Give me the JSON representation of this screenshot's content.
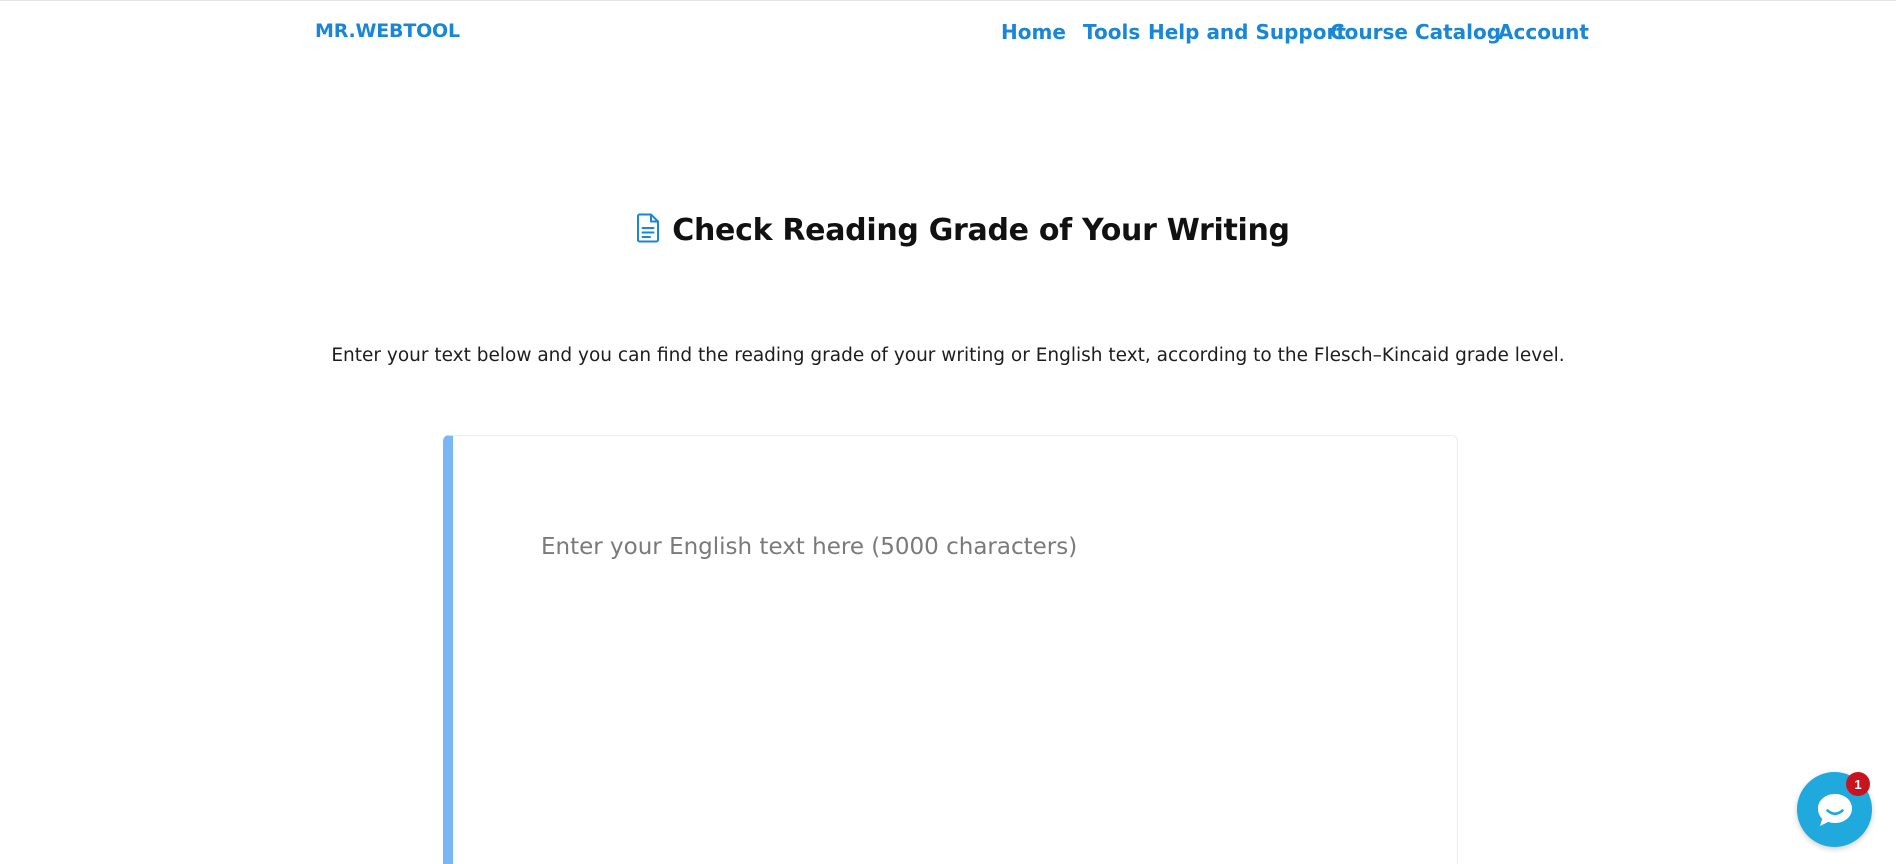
{
  "brand": {
    "name": "MR.WEBTOOL"
  },
  "nav": {
    "items": [
      {
        "label": "Home"
      },
      {
        "label": "Tools"
      },
      {
        "label": "Help and Support"
      },
      {
        "label": "Course Catalog"
      },
      {
        "label": "Account"
      }
    ]
  },
  "main": {
    "title": "Check Reading Grade of Your Writing",
    "icon": "document-icon",
    "description": "Enter your text below and you can find the reading grade of your writing or English text, according to the Flesch–Kincaid grade level.",
    "editor": {
      "placeholder": "Enter your English text here (5000 characters)",
      "value": ""
    }
  },
  "chat": {
    "icon": "chat-bubble-icon",
    "badge_count": "1"
  },
  "colors": {
    "brand": "#1a86d6",
    "editor_accent": "#7ab8f5",
    "chat": "#1fa9dc",
    "badge": "#c8141e"
  }
}
